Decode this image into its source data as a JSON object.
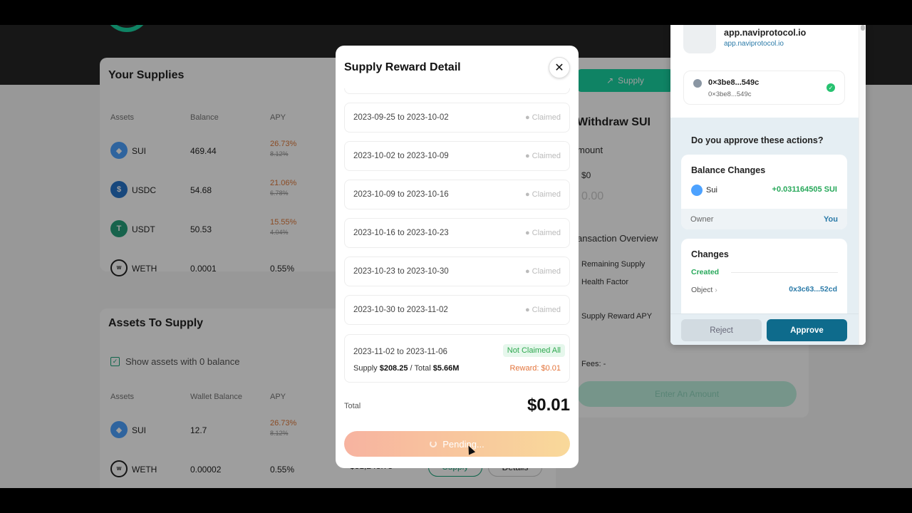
{
  "background": {
    "supplies": {
      "title": "Your Supplies",
      "headers": [
        "Assets",
        "Balance",
        "APY"
      ],
      "rows": [
        {
          "asset": "SUI",
          "balance": "469.44",
          "apy": "26.73%",
          "base_apy": "8.12%"
        },
        {
          "asset": "USDC",
          "balance": "54.68",
          "apy": "21.06%",
          "base_apy": "6.78%"
        },
        {
          "asset": "USDT",
          "balance": "50.53",
          "apy": "15.55%",
          "base_apy": "4.04%"
        },
        {
          "asset": "WETH",
          "balance": "0.0001",
          "apy": "0.55%",
          "base_apy": ""
        }
      ]
    },
    "to_supply": {
      "title": "Assets To Supply",
      "show_zero": "Show assets with 0 balance",
      "headers": [
        "Assets",
        "Wallet Balance",
        "APY"
      ],
      "rows": [
        {
          "asset": "SUI",
          "balance": "12.7",
          "apy": "26.73%",
          "base_apy": "8.12%"
        },
        {
          "asset": "WETH",
          "balance": "0.00002",
          "apy": "0.55%",
          "value": "$31,248.78",
          "supply_btn": "Supply",
          "details_btn": "Details"
        }
      ]
    },
    "right_panel": {
      "tab_supply": "Supply",
      "withdraw_title": "Withdraw SUI",
      "amount_label": "mount",
      "amount_usd": "$0",
      "amount_input": "0.00",
      "overview_label": "ansaction Overview",
      "remaining_supply": "Remaining Supply",
      "health_factor": "Health Factor",
      "supply_reward_apy": "Supply Reward APY",
      "fees": "Fees: -",
      "enter_amount": "Enter An Amount"
    }
  },
  "modal": {
    "title": "Supply Reward Detail",
    "rows": [
      {
        "period": "2023-09-25 to 2023-10-02",
        "status": "● Claimed"
      },
      {
        "period": "2023-10-02 to 2023-10-09",
        "status": "● Claimed"
      },
      {
        "period": "2023-10-09 to 2023-10-16",
        "status": "● Claimed"
      },
      {
        "period": "2023-10-16 to 2023-10-23",
        "status": "● Claimed"
      },
      {
        "period": "2023-10-23 to 2023-10-30",
        "status": "● Claimed"
      },
      {
        "period": "2023-10-30 to 2023-11-02",
        "status": "● Claimed"
      }
    ],
    "last_row": {
      "period": "2023-11-02 to 2023-11-06",
      "status": "Not Claimed All",
      "supply_label": "Supply",
      "supply_val": "$208.25",
      "sep": "/ Total",
      "total_val": "$5.66M",
      "reward": "Reward: $0.01"
    },
    "total_label": "Total",
    "total_value": "$0.01",
    "pending_label": "Pending..."
  },
  "wallet": {
    "site_name": "app.naviprotocol.io",
    "site_url": "app.naviprotocol.io",
    "account_address": "0×3be8...549c",
    "account_sub": "0×3be8...549c",
    "question": "Do you approve these actions?",
    "balance_changes": {
      "title": "Balance Changes",
      "coin": "Sui",
      "amount": "+0.031164505 SUI",
      "owner_label": "Owner",
      "owner_value": "You"
    },
    "changes": {
      "title": "Changes",
      "created": "Created",
      "object_label": "Object",
      "object_value": "0x3c63...52cd"
    },
    "reject_label": "Reject",
    "approve_label": "Approve"
  }
}
